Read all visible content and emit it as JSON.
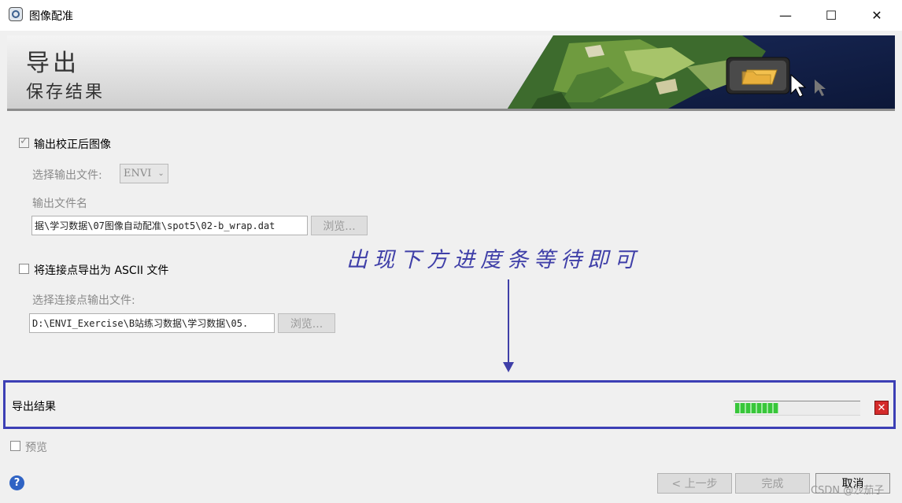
{
  "window": {
    "title": "图像配准",
    "minimize_glyph": "—",
    "maximize_glyph": "☐",
    "close_glyph": "✕"
  },
  "banner": {
    "title": "导出",
    "subtitle": "保存结果"
  },
  "output_image": {
    "checkbox_label": "输出校正后图像",
    "checked": true,
    "format_label": "选择输出文件:",
    "format_value": "ENVI",
    "filename_label": "输出文件名",
    "filename_value": "据\\学习数据\\07图像自动配准\\spot5\\02-b_wrap.dat",
    "browse_label": "浏览..."
  },
  "tiepoints": {
    "checkbox_label": "将连接点导出为 ASCII 文件",
    "checked": false,
    "file_label": "选择连接点输出文件:",
    "file_value": "D:\\ENVI_Exercise\\B站练习数据\\学习数据\\05.",
    "browse_label": "浏览..."
  },
  "annotation": {
    "text": "出现下方进度条等待即可",
    "color": "#3f3fa8"
  },
  "export": {
    "label": "导出结果",
    "progress_fraction": 0.35,
    "cancel_icon": "red-x-icon"
  },
  "preview": {
    "checkbox_label": "预览",
    "checked": false
  },
  "footer": {
    "help_glyph": "?",
    "back_label": "< 上一步",
    "finish_label": "完成",
    "cancel_label": "取消"
  },
  "watermark": "CSDN @沙茄子",
  "colors": {
    "highlight_border": "#3c3fb5",
    "progress_green": "#38c63a"
  }
}
